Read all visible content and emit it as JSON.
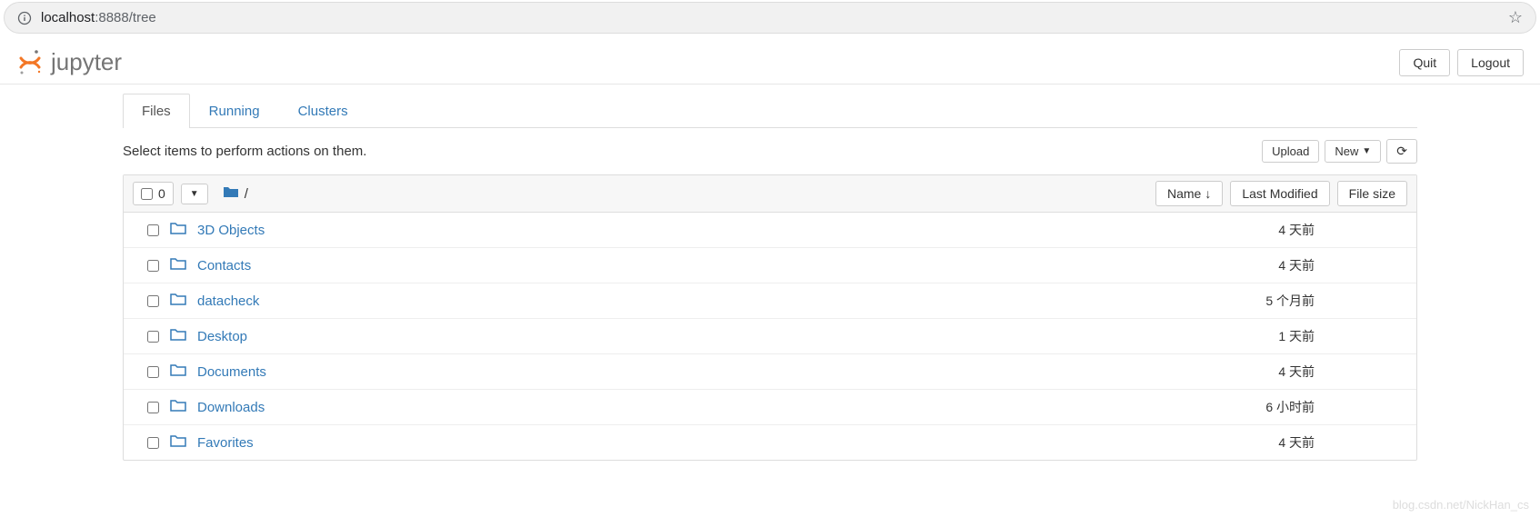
{
  "address": {
    "host": "localhost",
    "port_path": ":8888/tree"
  },
  "header": {
    "brand": "jupyter",
    "quit": "Quit",
    "logout": "Logout"
  },
  "tabs": [
    {
      "label": "Files",
      "active": true
    },
    {
      "label": "Running",
      "active": false
    },
    {
      "label": "Clusters",
      "active": false
    }
  ],
  "toolbar": {
    "hint": "Select items to perform actions on them.",
    "upload": "Upload",
    "new": "New"
  },
  "list_header": {
    "selected_count": "0",
    "breadcrumb_root": "/",
    "name_col": "Name",
    "modified_col": "Last Modified",
    "size_col": "File size"
  },
  "files": [
    {
      "name": "3D Objects",
      "modified": "4 天前",
      "size": ""
    },
    {
      "name": "Contacts",
      "modified": "4 天前",
      "size": ""
    },
    {
      "name": "datacheck",
      "modified": "5 个月前",
      "size": ""
    },
    {
      "name": "Desktop",
      "modified": "1 天前",
      "size": ""
    },
    {
      "name": "Documents",
      "modified": "4 天前",
      "size": ""
    },
    {
      "name": "Downloads",
      "modified": "6 小时前",
      "size": ""
    },
    {
      "name": "Favorites",
      "modified": "4 天前",
      "size": ""
    }
  ],
  "watermark": "blog.csdn.net/NickHan_cs"
}
